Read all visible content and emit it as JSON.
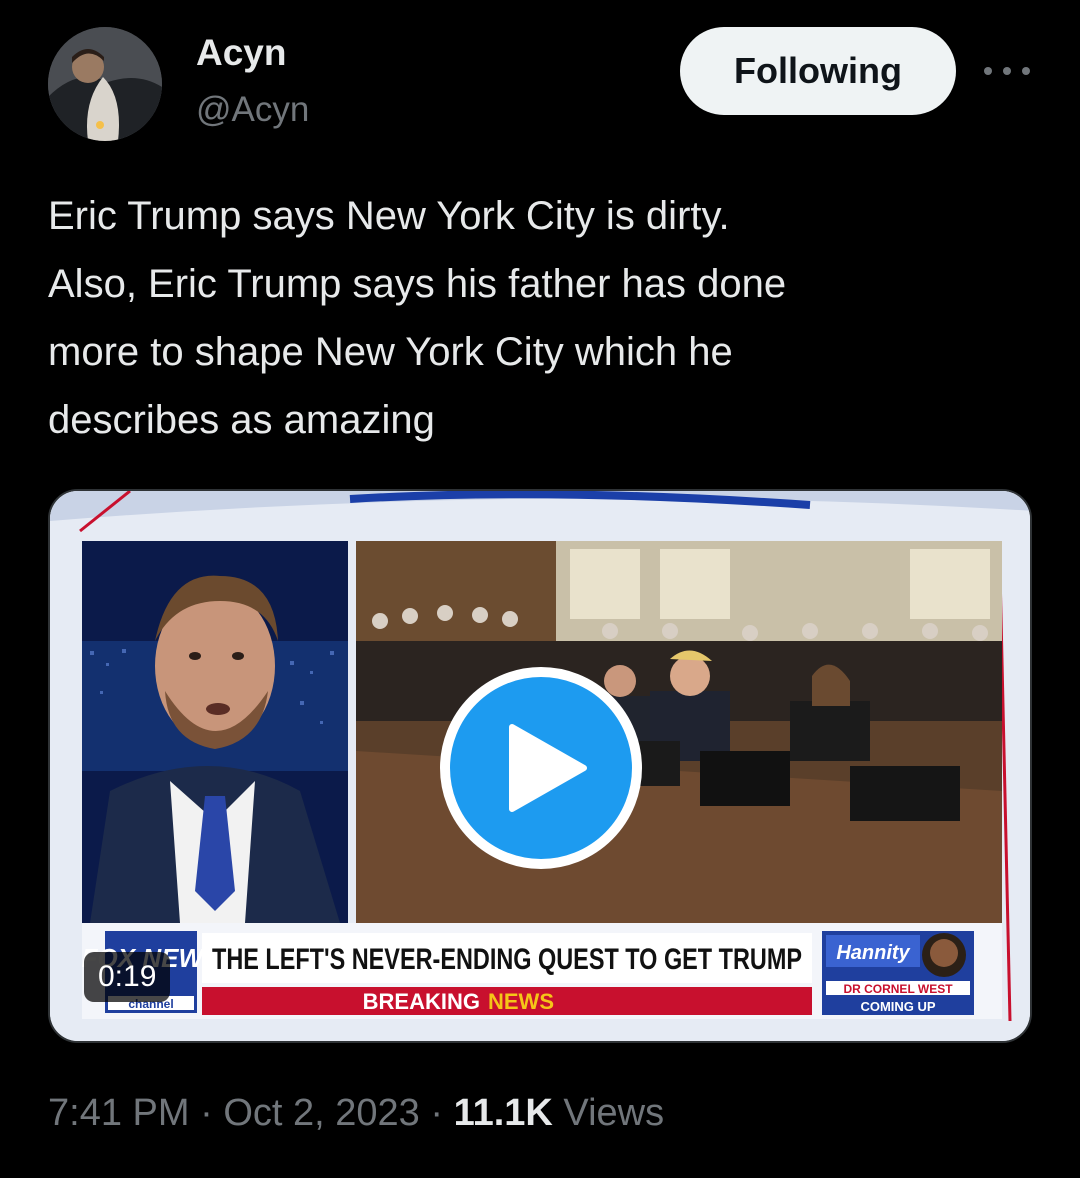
{
  "author": {
    "display_name": "Acyn",
    "handle": "@Acyn"
  },
  "follow_button": {
    "label": "Following"
  },
  "more_icon": "more-horizontal-icon",
  "tweet": {
    "text": "Eric Trump says New York City is dirty.\nAlso, Eric Trump says his father has done\nmore to shape New York City which he\ndescribes as amazing"
  },
  "video": {
    "duration": "0:19",
    "chyron_headline": "THE LEFT'S NEVER-ENDING QUEST TO GET TRUMP",
    "chyron_breaking": "BREAKING",
    "chyron_news": "NEWS",
    "network_logo": "FOX NEWS",
    "network_sub": "channel",
    "show_name": "Hannity",
    "promo_line1": "DR CORNEL WEST",
    "promo_line2": "COMING UP"
  },
  "meta": {
    "time": "7:41 PM",
    "separator": " · ",
    "date": "Oct 2, 2023",
    "views_count": "11.1K",
    "views_label": " Views"
  },
  "colors": {
    "background": "#000000",
    "text_primary": "#e7e9ea",
    "text_secondary": "#71767b",
    "accent_blue": "#1d9bf0",
    "button_bg": "#eff3f4"
  }
}
